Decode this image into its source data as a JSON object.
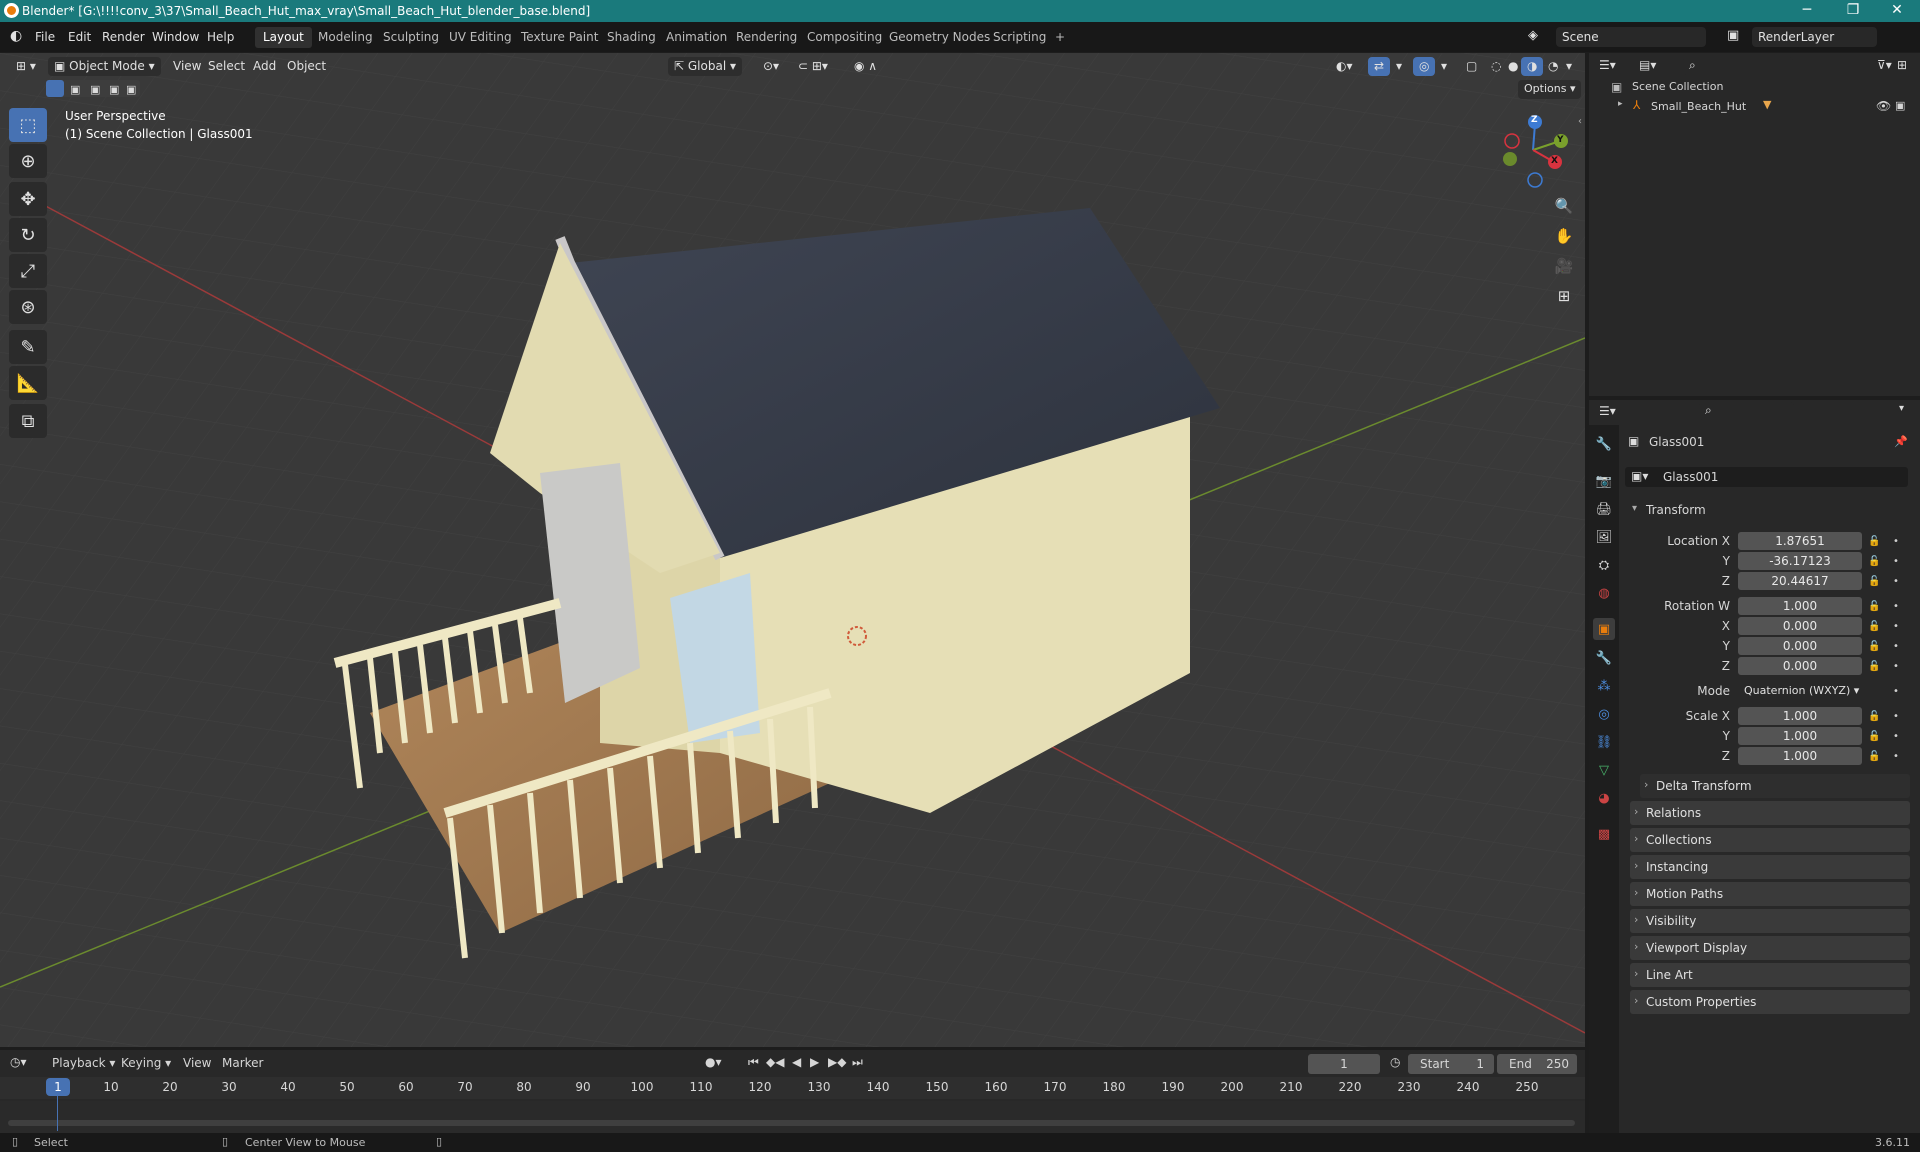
{
  "window": {
    "title": "Blender* [G:\\!!!!conv_3\\37\\Small_Beach_Hut_max_vray\\Small_Beach_Hut_blender_base.blend]",
    "minimize_glyph": "─",
    "maximize_glyph": "❐",
    "close_glyph": "✕"
  },
  "menubar": {
    "items": [
      "File",
      "Edit",
      "Render",
      "Window",
      "Help"
    ],
    "workspaces": [
      "Layout",
      "Modeling",
      "Sculpting",
      "UV Editing",
      "Texture Paint",
      "Shading",
      "Animation",
      "Rendering",
      "Compositing",
      "Geometry Nodes",
      "Scripting"
    ],
    "active_workspace": "Layout",
    "add_workspace": "+",
    "scene": "Scene",
    "render_layer": "RenderLayer"
  },
  "viewport": {
    "mode": "Object Mode",
    "menus": [
      "View",
      "Select",
      "Add",
      "Object"
    ],
    "orientation": "Global",
    "options_label": "Options",
    "info_line1": "User Perspective",
    "info_line2": "(1) Scene Collection | Glass001",
    "gizmo": {
      "x": "X",
      "y": "Y",
      "z": "Z"
    }
  },
  "outliner": {
    "root": "Scene Collection",
    "items": [
      {
        "name": "Small_Beach_Hut"
      }
    ]
  },
  "properties": {
    "object_name": "Glass001",
    "datablock_name": "Glass001",
    "transform_header": "Transform",
    "location": {
      "label_x": "Location X",
      "label_y": "Y",
      "label_z": "Z",
      "x": "1.87651",
      "y": "-36.17123",
      "z": "20.44617"
    },
    "rotation": {
      "label_w": "Rotation W",
      "label_x": "X",
      "label_y": "Y",
      "label_z": "Z",
      "w": "1.000",
      "x": "0.000",
      "y": "0.000",
      "z": "0.000"
    },
    "mode_label": "Mode",
    "mode_value": "Quaternion (WXYZ)",
    "scale": {
      "label_x": "Scale X",
      "label_y": "Y",
      "label_z": "Z",
      "x": "1.000",
      "y": "1.000",
      "z": "1.000"
    },
    "delta_transform": "Delta Transform",
    "panels": [
      "Relations",
      "Collections",
      "Instancing",
      "Motion Paths",
      "Visibility",
      "Viewport Display",
      "Line Art",
      "Custom Properties"
    ]
  },
  "timeline": {
    "menus": [
      "Playback",
      "Keying",
      "View",
      "Marker"
    ],
    "current_frame": "1",
    "start_label": "Start",
    "start": "1",
    "end_label": "End",
    "end": "250",
    "ruler": [
      "1",
      "10",
      "20",
      "30",
      "40",
      "50",
      "60",
      "70",
      "80",
      "90",
      "100",
      "110",
      "120",
      "130",
      "140",
      "150",
      "160",
      "170",
      "180",
      "190",
      "200",
      "210",
      "220",
      "230",
      "240",
      "250"
    ]
  },
  "statusbar": {
    "select": "Select",
    "center_view": "Center View to Mouse",
    "version": "3.6.11"
  },
  "colors": {
    "accent": "#4772b3",
    "titlebar": "#1a7a7c",
    "active_frame": "#4772b3"
  }
}
